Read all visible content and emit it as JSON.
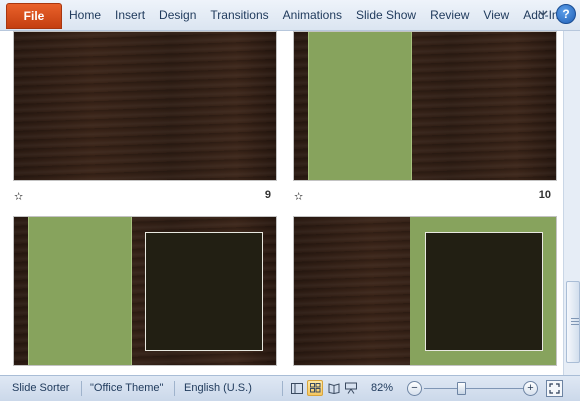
{
  "ribbon": {
    "file_label": "File",
    "tabs": [
      "Home",
      "Insert",
      "Design",
      "Transitions",
      "Animations",
      "Slide Show",
      "Review",
      "View",
      "Add-Ins"
    ],
    "minimize_icon": "chevron-icon",
    "help_label": "?"
  },
  "slides": [
    {
      "number": "9",
      "transition_icon": "star-icon"
    },
    {
      "number": "10",
      "transition_icon": "star-icon"
    }
  ],
  "status": {
    "view": "Slide Sorter",
    "theme": "\"Office Theme\"",
    "language": "English (U.S.)",
    "zoom": "82%",
    "zoom_out": "−",
    "zoom_in": "+"
  },
  "colors": {
    "accent_green": "#87a35d",
    "file_tab": "#d9501c",
    "dark_box": "#221f13"
  }
}
